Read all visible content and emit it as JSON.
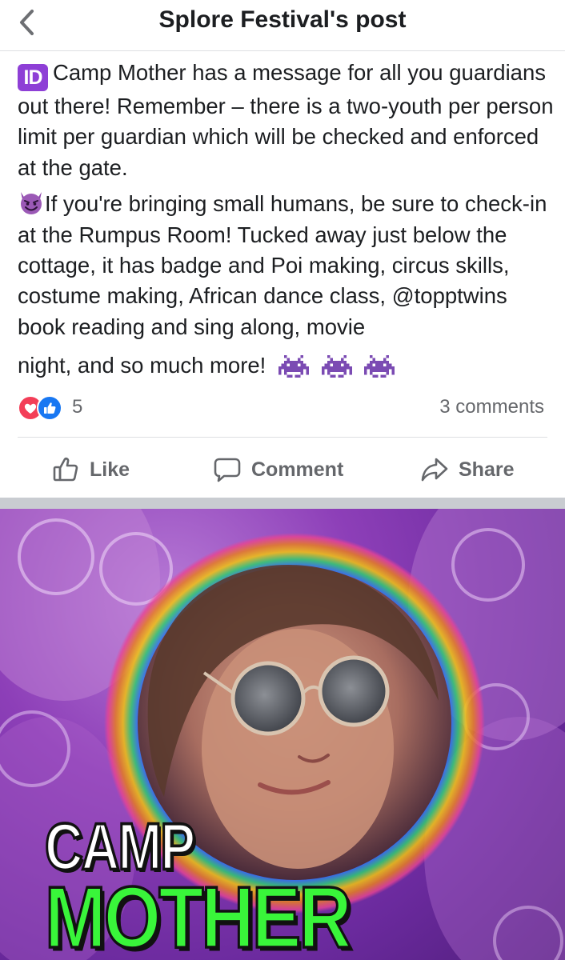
{
  "header": {
    "title": "Splore Festival's post",
    "back_icon": "chevron-left-icon"
  },
  "post": {
    "paragraph1_emoji": "ID",
    "paragraph1": "Camp Mother has a message for all you guardians out there! Remember – there is a two-youth per person limit per guardian which will be checked and enforced at the gate.",
    "paragraph2_lead": "If you're bringing small humans, be sure to check-in at the Rumpus Room! Tucked away just below the cottage, it has badge and Poi making, circus skills, costume making, African dance class, @topptwins book reading and sing along, movie",
    "paragraph2_end": "night, and so much more!",
    "emojis": [
      "purple-devil-emoji",
      "alien-monster-emoji",
      "alien-monster-emoji",
      "alien-monster-emoji"
    ]
  },
  "stats": {
    "reaction_count": "5",
    "comments": "3 comments",
    "reaction_icons": [
      "love-reaction-icon",
      "like-reaction-icon"
    ]
  },
  "actions": {
    "like": "Like",
    "comment": "Comment",
    "share": "Share"
  },
  "image": {
    "caption_line1": "CAMP",
    "caption_line2": "MOTHER",
    "colors": {
      "background": "#8d3fb8",
      "caption_line1": "#ffffff",
      "caption_line2": "#39f53a"
    }
  },
  "colors": {
    "text": "#1c1e21",
    "muted": "#65676b",
    "love": "#f33e58",
    "like": "#1877f2",
    "id_badge": "#8e3fd6"
  }
}
